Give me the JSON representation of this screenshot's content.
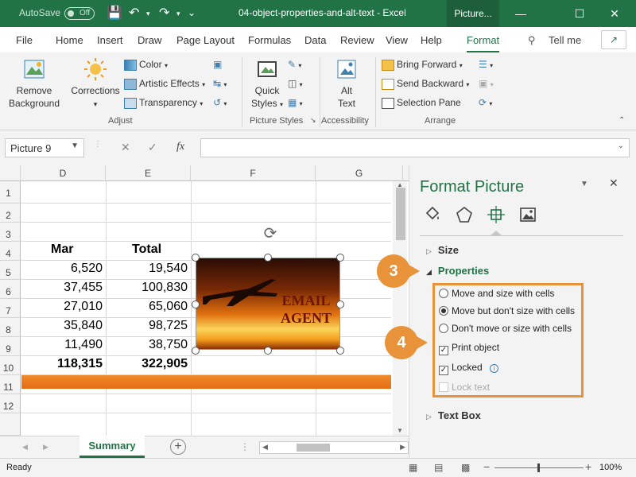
{
  "titlebar": {
    "autosave": "AutoSave",
    "toggle": "Off",
    "doc_title": "04-object-properties-and-alt-text  -  Excel",
    "context_tab": "Picture..."
  },
  "tabs": [
    "File",
    "Home",
    "Insert",
    "Draw",
    "Page Layout",
    "Formulas",
    "Data",
    "Review",
    "View",
    "Help",
    "Format"
  ],
  "tell_me": "Tell me",
  "ribbon": {
    "remove_bg": "Remove\nBackground",
    "corrections": "Corrections",
    "color": "Color",
    "artistic": "Artistic Effects",
    "transparency": "Transparency",
    "adjust": "Adjust",
    "quick_styles": "Quick\nStyles",
    "picture_styles": "Picture Styles",
    "alt_text": "Alt\nText",
    "accessibility": "Accessibility",
    "bring_forward": "Bring Forward",
    "send_backward": "Send Backward",
    "selection_pane": "Selection Pane",
    "arrange": "Arrange"
  },
  "namebox": "Picture 9",
  "fx": "fx",
  "columns": [
    "D",
    "E",
    "F",
    "G"
  ],
  "rows": [
    "1",
    "2",
    "3",
    "4",
    "5",
    "6",
    "7",
    "8",
    "9",
    "10",
    "11",
    "12"
  ],
  "cells": {
    "d3": "Mar",
    "e3": "Total",
    "d4": "6,520",
    "e4": "19,540",
    "d5": "37,455",
    "e5": "100,830",
    "d6": "27,010",
    "e6": "65,060",
    "d7": "35,840",
    "e7": "98,725",
    "d8": "11,490",
    "e8": "38,750",
    "d9": "118,315",
    "e9": "322,905"
  },
  "picture_text": "EMAIL AGENT",
  "sheet_tab": "Summary",
  "status": "Ready",
  "zoom": "100%",
  "pane": {
    "title": "Format Picture",
    "size": "Size",
    "properties": "Properties",
    "text_box": "Text Box",
    "opt_move_size": "Move and size with cells",
    "opt_move_only": "Move but don't size with cells",
    "opt_dont_move": "Don't move or size with cells",
    "print_object": "Print object",
    "locked": "Locked",
    "lock_text": "Lock text",
    "selected_option": "Move but don't size with cells",
    "print_checked": true,
    "locked_checked": true,
    "lock_text_enabled": false
  },
  "callouts": [
    "3",
    "4"
  ],
  "colors": {
    "excel_green": "#217346",
    "callout": "#e8923a",
    "row_fill": "#e86f12"
  }
}
